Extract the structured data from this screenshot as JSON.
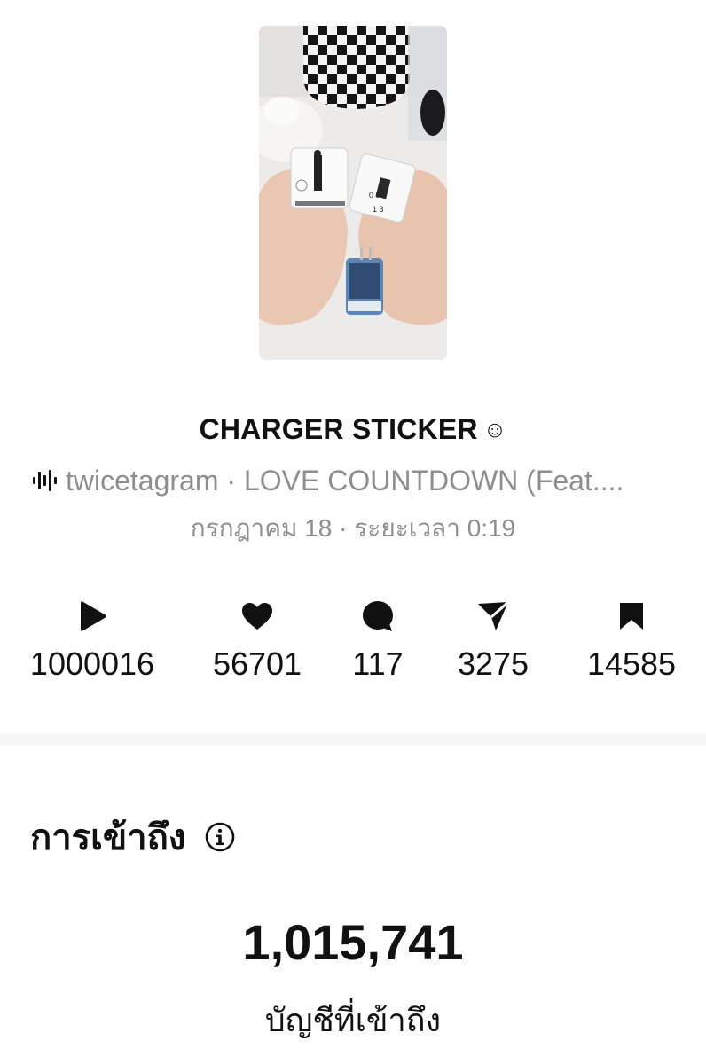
{
  "post": {
    "title": "CHARGER STICKER",
    "title_emoji": "☺",
    "audio": "twicetagram · LOVE COUNTDOWN (Feat....",
    "meta": "กรกฎาคม 18 · ระยะเวลา 0:19"
  },
  "stats": [
    {
      "icon": "play-icon",
      "value": "1000016"
    },
    {
      "icon": "heart-icon",
      "value": "56701"
    },
    {
      "icon": "comment-icon",
      "value": "117"
    },
    {
      "icon": "send-icon",
      "value": "3275"
    },
    {
      "icon": "bookmark-icon",
      "value": "14585"
    }
  ],
  "reach": {
    "title": "การเข้าถึง",
    "value": "1,015,741",
    "label": "บัญชีที่เข้าถึง"
  },
  "colors": {
    "text": "#111111",
    "secondary": "#8e8e8e",
    "divider": "#f7f7f7"
  }
}
